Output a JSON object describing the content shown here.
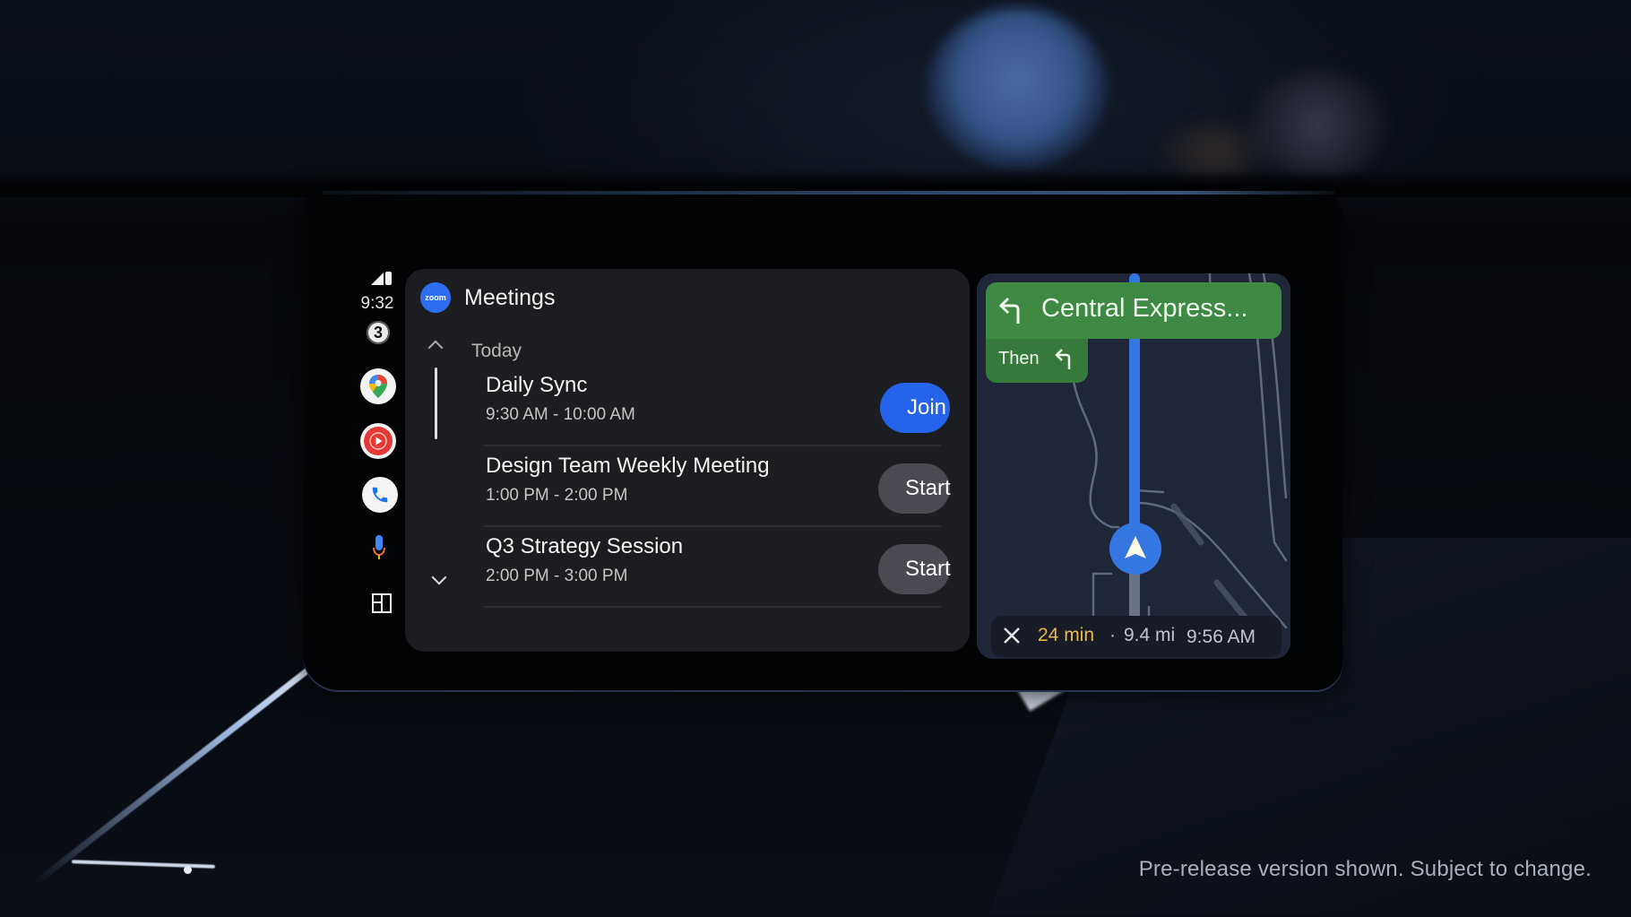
{
  "status_rail": {
    "time": "9:32",
    "notification_count": "3",
    "apps": [
      {
        "name": "Google Maps",
        "icon": "maps-icon"
      },
      {
        "name": "YouTube Music",
        "icon": "youtube-music-icon"
      },
      {
        "name": "Phone",
        "icon": "phone-icon"
      }
    ],
    "assistant_icon": "microphone-icon",
    "launcher_icon": "layout-grid-icon"
  },
  "meetings_panel": {
    "app_logo_text": "zoom",
    "title": "Meetings",
    "section_label": "Today",
    "meetings": [
      {
        "name": "Daily Sync",
        "time": "9:30 AM - 10:00 AM",
        "action": "Join",
        "action_style": "primary"
      },
      {
        "name": "Design Team Weekly Meeting",
        "time": "1:00 PM - 2:00 PM",
        "action": "Start",
        "action_style": "secondary"
      },
      {
        "name": "Q3 Strategy Session",
        "time": "2:00 PM - 3:00 PM",
        "action": "Start",
        "action_style": "secondary"
      }
    ]
  },
  "navigation": {
    "next_street": "Central Express...",
    "next_turn": "turn-left",
    "then_label": "Then",
    "then_turn": "turn-left",
    "eta_duration": "24 min",
    "eta_separator": "·",
    "eta_distance": "9.4 mi",
    "eta_arrival": "9:56 AM"
  },
  "colors": {
    "join_button": "#2563eb",
    "start_button": "#4a4b52",
    "nav_card": "#3e8a43",
    "route_line": "#3577e2",
    "eta_duration": "#e8b84a"
  },
  "disclaimer": "Pre-release version shown. Subject to change."
}
